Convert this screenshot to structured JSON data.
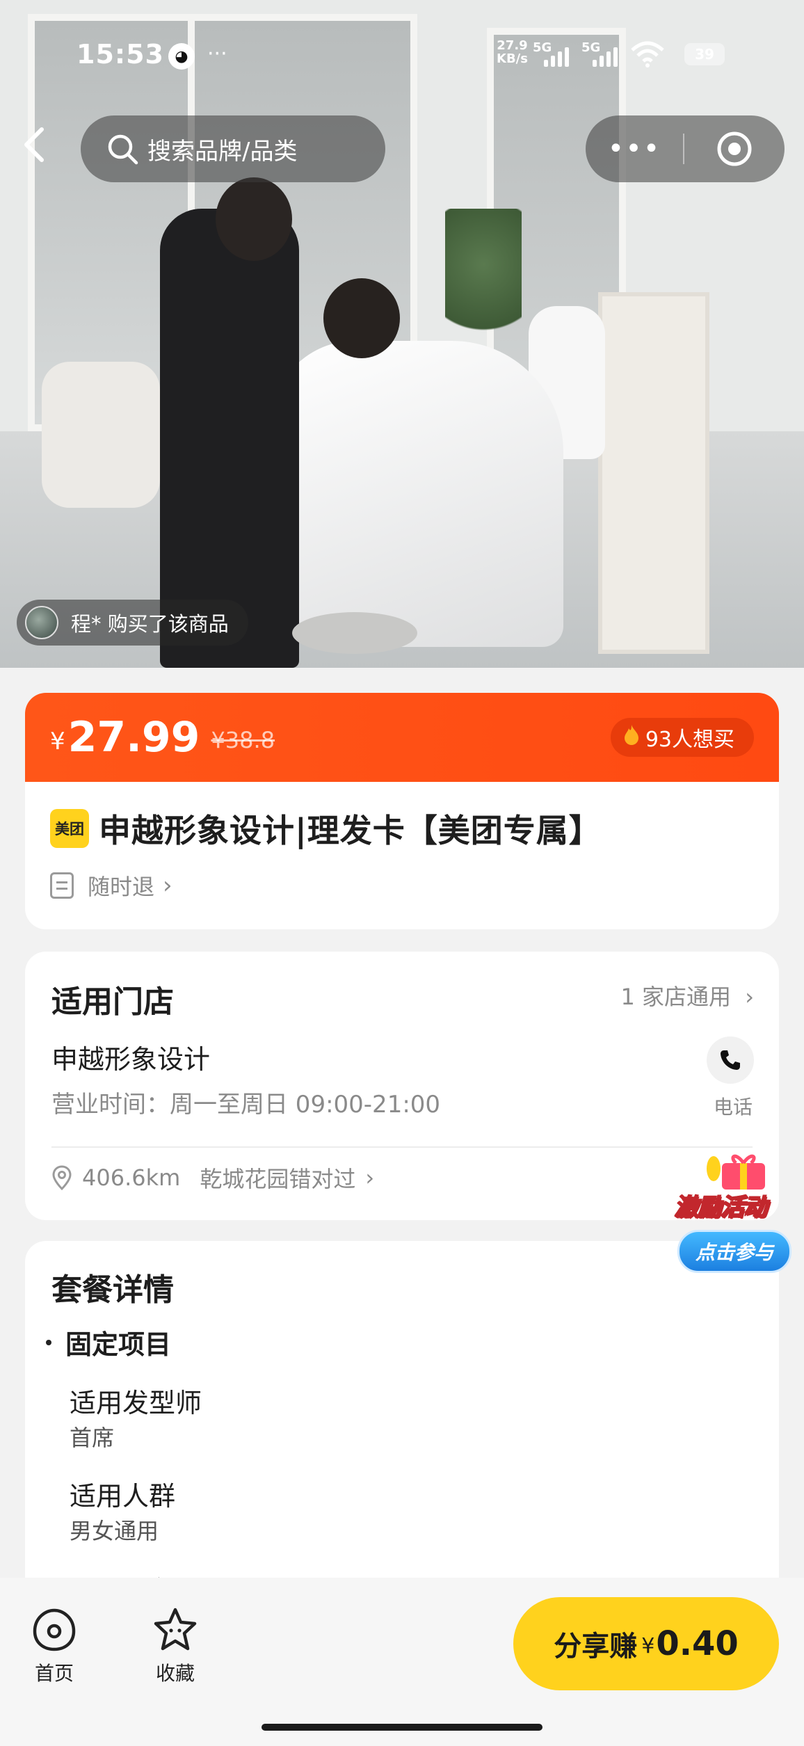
{
  "status_bar": {
    "time": "15:53",
    "dots": "···",
    "net_speed_value": "27.9",
    "net_speed_unit": "KB/s",
    "sim1": "5G",
    "sim2": "5G",
    "battery": "39"
  },
  "nav": {
    "back_icon": "chevron-left-icon",
    "search_placeholder": "搜索品牌/品类",
    "more_label": "•••",
    "target_icon": "target-icon"
  },
  "hero": {
    "buyer_notice": "程* 购买了该商品"
  },
  "price": {
    "currency": "¥",
    "current": "27.99",
    "original": "¥38.8",
    "want_count": "93人想买",
    "accent_color": "#ff5618"
  },
  "product": {
    "brand_badge": "美团",
    "title": "申越形象设计|理发卡【美团专属】",
    "refund_label": "随时退",
    "chevron": "›"
  },
  "store": {
    "heading": "适用门店",
    "count_label": "1 家店通用",
    "chevron": "›",
    "name": "申越形象设计",
    "hours": "营业时间：周一至周日 09:00-21:00",
    "phone_label": "电话",
    "distance": "406.6km",
    "address": "乾城花园错对过"
  },
  "package": {
    "heading": "套餐详情",
    "section": "固定项目",
    "items": [
      {
        "label": "适用发型师",
        "value": "首席"
      },
      {
        "label": "适用人群",
        "value": "男女通用"
      }
    ],
    "cut_off_text": "可用时段"
  },
  "promo": {
    "label": "激励活动",
    "button": "点击参与"
  },
  "bottom_bar": {
    "home_label": "首页",
    "favorite_label": "收藏",
    "share_label": "分享赚",
    "share_currency": "¥",
    "share_amount": "0.40",
    "share_color": "#ffd21d"
  }
}
